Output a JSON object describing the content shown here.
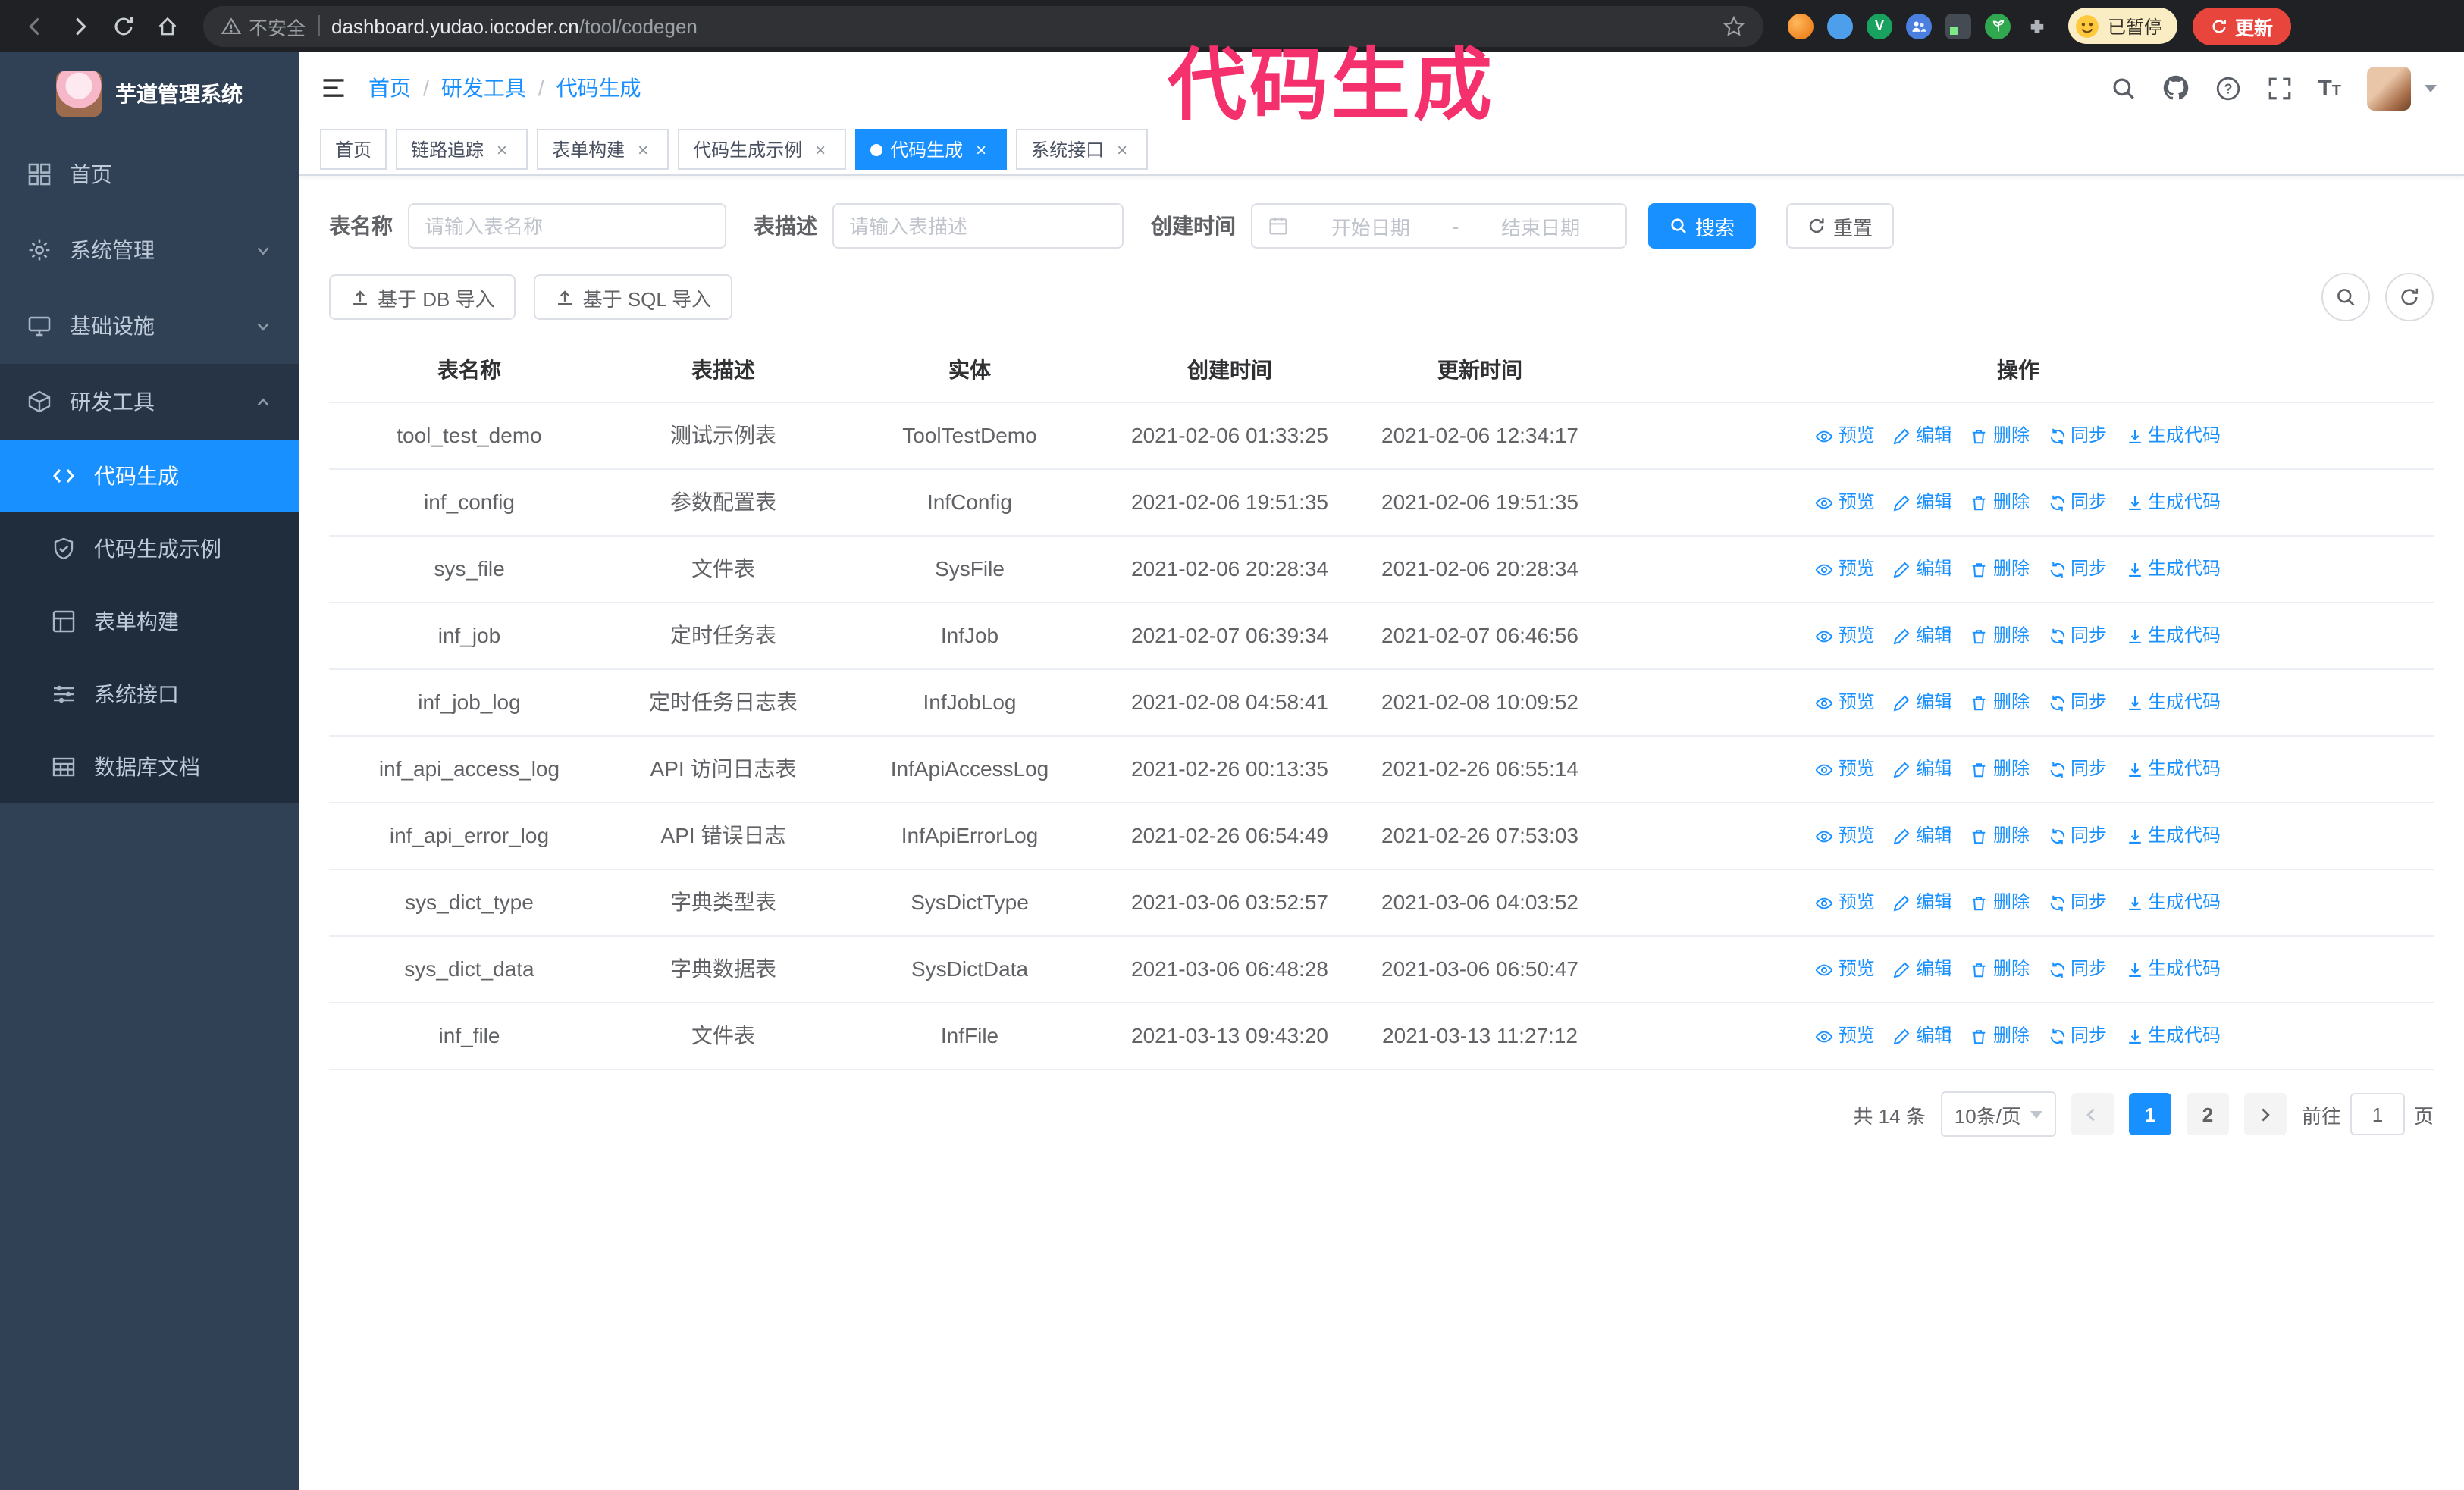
{
  "colors": {
    "accent": "#1890ff",
    "annotation": "#f5316d",
    "sidebar_bg": "#304156",
    "submenu_bg": "#1f2d3d"
  },
  "annotation": {
    "text": "代码生成"
  },
  "browser": {
    "security_label": "不安全",
    "url_host": "dashboard.yudao.iocoder.cn",
    "url_path": "/tool/codegen",
    "paused_badge": "已暂停",
    "update_button": "更新",
    "ext3_letter": "V"
  },
  "sidebar": {
    "logo_title": "芋道管理系统",
    "items": [
      "首页",
      "系统管理",
      "基础设施",
      "研发工具"
    ],
    "submenu": [
      "代码生成",
      "代码生成示例",
      "表单构建",
      "系统接口",
      "数据库文档"
    ]
  },
  "header": {
    "breadcrumb": [
      "首页",
      "研发工具",
      "代码生成"
    ]
  },
  "tabs": [
    {
      "label": "首页",
      "closable": false,
      "active": false
    },
    {
      "label": "链路追踪",
      "closable": true,
      "active": false
    },
    {
      "label": "表单构建",
      "closable": true,
      "active": false
    },
    {
      "label": "代码生成示例",
      "closable": true,
      "active": false
    },
    {
      "label": "代码生成",
      "closable": true,
      "active": true
    },
    {
      "label": "系统接口",
      "closable": true,
      "active": false
    }
  ],
  "filters": {
    "name_label": "表名称",
    "name_placeholder": "请输入表名称",
    "desc_label": "表描述",
    "desc_placeholder": "请输入表描述",
    "time_label": "创建时间",
    "start_placeholder": "开始日期",
    "range_separator": "-",
    "end_placeholder": "结束日期",
    "search_button": "搜索",
    "reset_button": "重置"
  },
  "toolbar": {
    "import_db": "基于 DB 导入",
    "import_sql": "基于 SQL 导入"
  },
  "table": {
    "columns": [
      "表名称",
      "表描述",
      "实体",
      "创建时间",
      "更新时间",
      "操作"
    ],
    "actions": [
      "预览",
      "编辑",
      "删除",
      "同步",
      "生成代码"
    ],
    "rows": [
      {
        "name": "tool_test_demo",
        "desc": "测试示例表",
        "entity": "ToolTestDemo",
        "created": "2021-02-06 01:33:25",
        "updated": "2021-02-06 12:34:17"
      },
      {
        "name": "inf_config",
        "desc": "参数配置表",
        "entity": "InfConfig",
        "created": "2021-02-06 19:51:35",
        "updated": "2021-02-06 19:51:35"
      },
      {
        "name": "sys_file",
        "desc": "文件表",
        "entity": "SysFile",
        "created": "2021-02-06 20:28:34",
        "updated": "2021-02-06 20:28:34"
      },
      {
        "name": "inf_job",
        "desc": "定时任务表",
        "entity": "InfJob",
        "created": "2021-02-07 06:39:34",
        "updated": "2021-02-07 06:46:56"
      },
      {
        "name": "inf_job_log",
        "desc": "定时任务日志表",
        "entity": "InfJobLog",
        "created": "2021-02-08 04:58:41",
        "updated": "2021-02-08 10:09:52"
      },
      {
        "name": "inf_api_access_log",
        "desc": "API 访问日志表",
        "entity": "InfApiAccessLog",
        "created": "2021-02-26 00:13:35",
        "updated": "2021-02-26 06:55:14"
      },
      {
        "name": "inf_api_error_log",
        "desc": "API 错误日志",
        "entity": "InfApiErrorLog",
        "created": "2021-02-26 06:54:49",
        "updated": "2021-02-26 07:53:03"
      },
      {
        "name": "sys_dict_type",
        "desc": "字典类型表",
        "entity": "SysDictType",
        "created": "2021-03-06 03:52:57",
        "updated": "2021-03-06 04:03:52"
      },
      {
        "name": "sys_dict_data",
        "desc": "字典数据表",
        "entity": "SysDictData",
        "created": "2021-03-06 06:48:28",
        "updated": "2021-03-06 06:50:47"
      },
      {
        "name": "inf_file",
        "desc": "文件表",
        "entity": "InfFile",
        "created": "2021-03-13 09:43:20",
        "updated": "2021-03-13 11:27:12"
      }
    ]
  },
  "pagination": {
    "total": "共 14 条",
    "page_size": "10条/页",
    "pages": [
      "1",
      "2"
    ],
    "active_page": "1",
    "goto_label": "前往",
    "goto_value": "1",
    "goto_suffix": "页"
  }
}
